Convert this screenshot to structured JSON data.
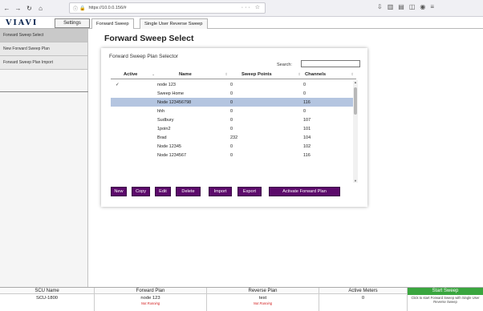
{
  "browser": {
    "url": "https://10.0.0.156/#",
    "back_icon": "back-arrow-icon",
    "forward_icon": "forward-arrow-icon",
    "reload_icon": "reload-icon",
    "home_icon": "home-icon"
  },
  "header": {
    "logo": "VIAVI",
    "settings_label": "Settings",
    "tabs": [
      {
        "label": "Forward Sweep",
        "active": true
      },
      {
        "label": "Single User Reverse Sweep",
        "active": false
      }
    ]
  },
  "sidebar": {
    "items": [
      {
        "label": "Forward Sweep Select",
        "active": true
      },
      {
        "label": "New Forward Sweep Plan",
        "active": false
      },
      {
        "label": "Forward Sweep Plan Import",
        "active": false
      }
    ]
  },
  "main": {
    "title": "Forward Sweep Select",
    "selector": {
      "title": "Forward Sweep Plan Selector",
      "search_label": "Search:",
      "search_value": "",
      "columns": [
        "Active",
        "Name",
        "Sweep Points",
        "Channels"
      ],
      "rows": [
        {
          "active": "✓",
          "name": "node 123",
          "points": "0",
          "channels": "0",
          "selected": false
        },
        {
          "active": "",
          "name": "Sweep Home",
          "points": "0",
          "channels": "0",
          "selected": false
        },
        {
          "active": "",
          "name": "Node 123456798",
          "points": "0",
          "channels": "116",
          "selected": true
        },
        {
          "active": "",
          "name": "hhh",
          "points": "0",
          "channels": "0",
          "selected": false
        },
        {
          "active": "",
          "name": "Sudbury",
          "points": "0",
          "channels": "107",
          "selected": false
        },
        {
          "active": "",
          "name": "1poin2",
          "points": "0",
          "channels": "101",
          "selected": false
        },
        {
          "active": "",
          "name": "Brad",
          "points": "232",
          "channels": "104",
          "selected": false
        },
        {
          "active": "",
          "name": "Node 12345",
          "points": "0",
          "channels": "102",
          "selected": false
        },
        {
          "active": "",
          "name": "Node 1234567",
          "points": "0",
          "channels": "116",
          "selected": false
        }
      ],
      "buttons": {
        "new": "New",
        "copy": "Copy",
        "edit": "Edit",
        "delete": "Delete",
        "import": "Import",
        "export": "Export",
        "activate": "Activate Forward Plan"
      }
    }
  },
  "footer": {
    "scu_name_label": "SCU Name",
    "scu_name_value": "SCU-1800",
    "forward_plan_label": "Forward Plan",
    "forward_plan_value": "node 123",
    "forward_plan_status": "Not Running",
    "reverse_plan_label": "Reverse Plan",
    "reverse_plan_value": "test",
    "reverse_plan_status": "Not Running",
    "active_meters_label": "Active Meters",
    "active_meters_value": "0",
    "start_sweep_label": "Start Sweep",
    "start_sweep_hint": "Click to start Forward Sweep with Single User Reverse Sweep"
  },
  "colors": {
    "button_purple": "#5c0a6b",
    "selected_row": "#b4c5e0",
    "start_green": "#3aa63f",
    "status_red": "#d21a1a"
  }
}
